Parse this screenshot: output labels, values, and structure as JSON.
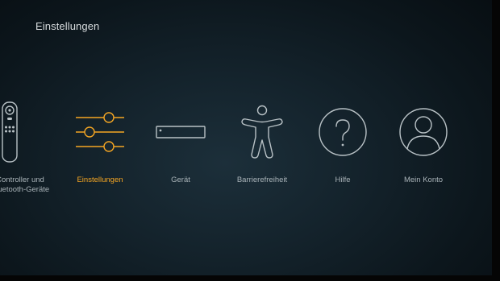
{
  "header": {
    "title": "Einstellungen"
  },
  "menu": {
    "items": [
      {
        "label": "Controller und\nBluetooth-Geräte",
        "icon": "remote-control-icon"
      },
      {
        "label": "Einstellungen",
        "icon": "sliders-icon",
        "selected": true
      },
      {
        "label": "Gerät",
        "icon": "fire-tv-box-icon"
      },
      {
        "label": "Barrierefreiheit",
        "icon": "accessibility-person-icon"
      },
      {
        "label": "Hilfe",
        "icon": "help-question-icon"
      },
      {
        "label": "Mein Konto",
        "icon": "account-user-icon"
      }
    ]
  },
  "colors": {
    "accent": "#f5a623",
    "text": "#a9b3b8",
    "icon": "#b9c2c6"
  }
}
